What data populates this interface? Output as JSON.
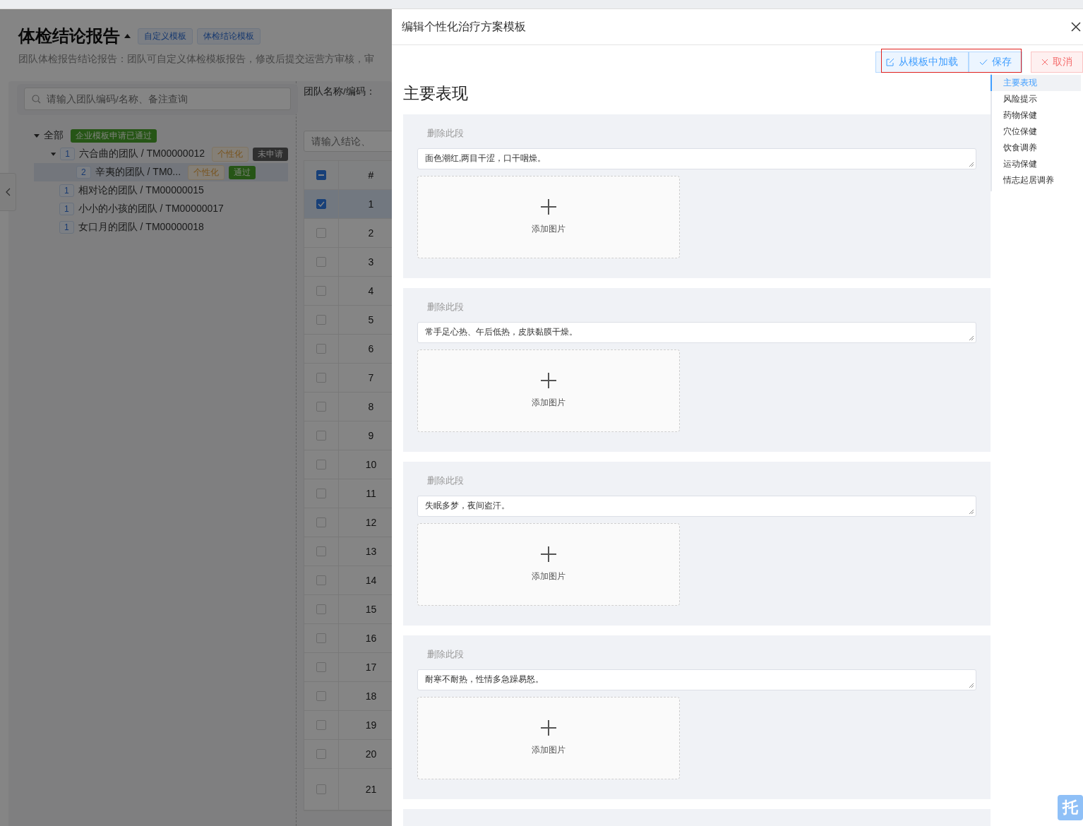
{
  "page": {
    "title": "体检结论报告",
    "tabs": [
      {
        "label": "自定义模板"
      },
      {
        "label": "体检结论模板"
      }
    ],
    "description": "团队体检报告结论报告：团队可自定义体检模板报告，修改后提交运营方审核，审",
    "search": {
      "placeholder": "请输入团队编码/名称、备注查询"
    },
    "tree": [
      {
        "label": "全部",
        "expanded": true,
        "selected": false,
        "tags": [
          {
            "kind": "approved",
            "text": "企业模板申请已通过"
          }
        ],
        "children": [
          {
            "count": "1",
            "label": "六合曲的团队 / TM00000012",
            "expanded": true,
            "selected": false,
            "tags": [
              {
                "kind": "personal",
                "text": "个性化"
              },
              {
                "kind": "pending",
                "text": "未申请"
              }
            ],
            "children": [
              {
                "count": "2",
                "label": "辛夷的团队 / TM0...",
                "selected": true,
                "tags": [
                  {
                    "kind": "personal",
                    "text": "个性化"
                  },
                  {
                    "kind": "passed",
                    "text": "通过"
                  }
                ]
              }
            ]
          },
          {
            "count": "1",
            "label": "相对论的团队 / TM00000015",
            "selected": false
          },
          {
            "count": "1",
            "label": "小小的小孩的团队 / TM00000017",
            "selected": false
          },
          {
            "count": "1",
            "label": "女口月的团队 / TM00000018",
            "selected": false
          }
        ]
      }
    ],
    "filter_label": "团队名称/编码：",
    "filter_search": {
      "placeholder": "请输入结论、"
    },
    "table": {
      "header_checkbox": {
        "indeterminate": true
      },
      "columns": [
        "#"
      ],
      "rows": [
        {
          "index": "1",
          "checked": true
        },
        {
          "index": "2",
          "checked": false
        },
        {
          "index": "3",
          "checked": false
        },
        {
          "index": "4",
          "checked": false
        },
        {
          "index": "5",
          "checked": false
        },
        {
          "index": "6",
          "checked": false
        },
        {
          "index": "7",
          "checked": false
        },
        {
          "index": "8",
          "checked": false
        },
        {
          "index": "9",
          "checked": false
        },
        {
          "index": "10",
          "checked": false
        },
        {
          "index": "11",
          "checked": false
        },
        {
          "index": "12",
          "checked": false
        },
        {
          "index": "13",
          "checked": false
        },
        {
          "index": "14",
          "checked": false
        },
        {
          "index": "15",
          "checked": false
        },
        {
          "index": "16",
          "checked": false
        },
        {
          "index": "17",
          "checked": false
        },
        {
          "index": "18",
          "checked": false
        },
        {
          "index": "19",
          "checked": false
        },
        {
          "index": "20",
          "checked": false
        },
        {
          "index": "21",
          "checked": false
        }
      ]
    }
  },
  "drawer": {
    "title": "编辑个性化治疗方案模板",
    "buttons": [
      {
        "kind": "load",
        "label": "从模板中加载"
      },
      {
        "kind": "save",
        "label": "保存"
      },
      {
        "kind": "cancel",
        "label": "取消"
      }
    ],
    "heading": "主要表现",
    "sections": [
      {
        "delete_label": "删除此段",
        "text": "面色潮红,两目干涩，口干咽燥。",
        "upload_label": "添加图片"
      },
      {
        "delete_label": "删除此段",
        "text": "常手足心热、午后低热，皮肤黏膜干燥。",
        "upload_label": "添加图片"
      },
      {
        "delete_label": "删除此段",
        "text": "失眠多梦，夜间盗汗。",
        "upload_label": "添加图片"
      },
      {
        "delete_label": "删除此段",
        "text": "耐寒不耐热，性情多急躁易怒。",
        "upload_label": "添加图片"
      }
    ],
    "nav": [
      {
        "label": "主要表现",
        "selected": true
      },
      {
        "label": "风险提示",
        "selected": false
      },
      {
        "label": "药物保健",
        "selected": false
      },
      {
        "label": "穴位保健",
        "selected": false
      },
      {
        "label": "饮食调养",
        "selected": false
      },
      {
        "label": "运动保健",
        "selected": false
      },
      {
        "label": "情志起居调养",
        "selected": false
      }
    ]
  },
  "float_button": "托"
}
